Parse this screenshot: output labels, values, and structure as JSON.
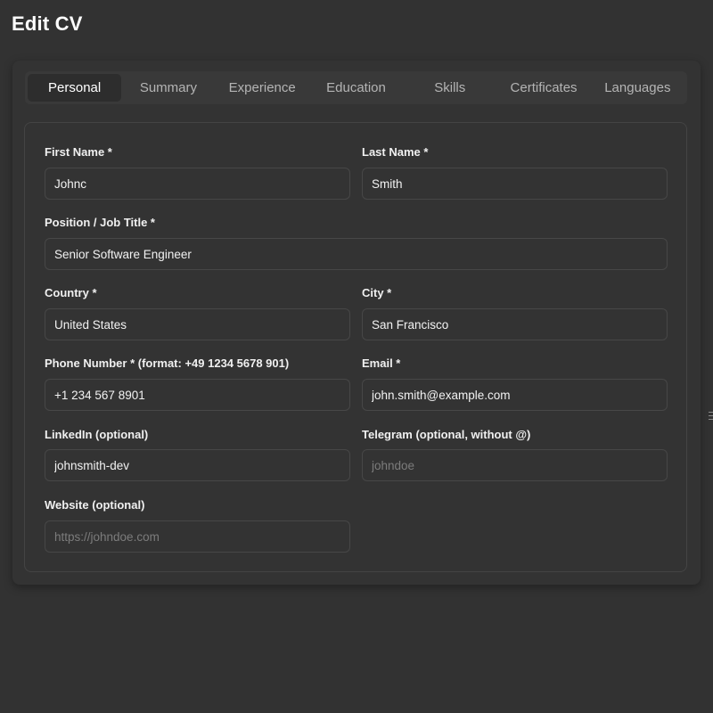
{
  "header": {
    "title": "Edit CV"
  },
  "tabs": [
    {
      "label": "Personal",
      "active": true
    },
    {
      "label": "Summary",
      "active": false
    },
    {
      "label": "Experience",
      "active": false
    },
    {
      "label": "Education",
      "active": false
    },
    {
      "label": "Skills",
      "active": false
    },
    {
      "label": "Certificates",
      "active": false
    },
    {
      "label": "Languages",
      "active": false
    }
  ],
  "form": {
    "first_name": {
      "label": "First Name *",
      "value": "Johnc",
      "placeholder": ""
    },
    "last_name": {
      "label": "Last Name *",
      "value": "Smith",
      "placeholder": ""
    },
    "position": {
      "label": "Position / Job Title *",
      "value": "Senior Software Engineer",
      "placeholder": ""
    },
    "country": {
      "label": "Country *",
      "value": "United States",
      "placeholder": ""
    },
    "city": {
      "label": "City *",
      "value": "San Francisco",
      "placeholder": ""
    },
    "phone": {
      "label": "Phone Number * (format: +49 1234 5678 901)",
      "value": "+1 234 567 8901",
      "placeholder": ""
    },
    "email": {
      "label": "Email *",
      "value": "john.smith@example.com",
      "placeholder": ""
    },
    "linkedin": {
      "label": "LinkedIn (optional)",
      "value": "johnsmith-dev",
      "placeholder": ""
    },
    "telegram": {
      "label": "Telegram (optional, without @)",
      "value": "",
      "placeholder": "johndoe"
    },
    "website": {
      "label": "Website (optional)",
      "value": "",
      "placeholder": "https://johndoe.com"
    }
  },
  "colors": {
    "background": "#323232",
    "tab_active": "#2d2d2d",
    "tab_bar": "#393939",
    "input_border": "#474747",
    "placeholder": "#7c7c7c"
  }
}
